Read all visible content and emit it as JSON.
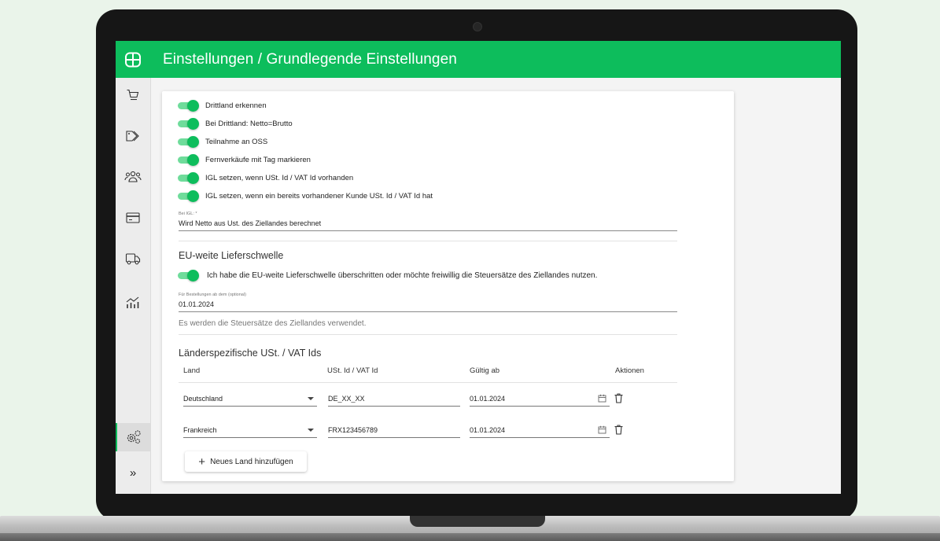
{
  "app": {
    "title": "Einstellungen / Grundlegende Einstellungen",
    "accent_color": "#0dbd5c"
  },
  "sidebar": {
    "items": [
      {
        "icon": "cart-icon"
      },
      {
        "icon": "tags-icon"
      },
      {
        "icon": "users-icon"
      },
      {
        "icon": "credit-card-icon"
      },
      {
        "icon": "truck-icon"
      },
      {
        "icon": "chart-icon"
      },
      {
        "icon": "settings-gears-icon",
        "active": true
      }
    ],
    "expand_label": "»"
  },
  "toggles": [
    {
      "label": "Drittland erkennen",
      "on": true
    },
    {
      "label": "Bei Drittland: Netto=Brutto",
      "on": true
    },
    {
      "label": "Teilnahme an OSS",
      "on": true
    },
    {
      "label": "Fernverkäufe mit Tag markieren",
      "on": true
    },
    {
      "label": "IGL setzen, wenn USt. Id / VAT Id vorhanden",
      "on": true
    },
    {
      "label": "IGL setzen, wenn ein bereits vorhandener Kunde USt. Id / VAT Id hat",
      "on": true
    }
  ],
  "igl_field": {
    "label": "Bei IGL: *",
    "value": "Wird Netto aus Ust. des Ziellandes berechnet"
  },
  "eu_section": {
    "title": "EU-weite Lieferschwelle",
    "toggle_label": "Ich habe die EU-weite Lieferschwelle überschritten oder möchte freiwillig die Steuersätze des Ziellandes nutzen.",
    "toggle_on": true,
    "date_field": {
      "label": "Für Bestellungen ab dem (optional)",
      "value": "01.01.2024"
    },
    "hint": "Es werden die Steuersätze des Ziellandes verwendet."
  },
  "vat_section": {
    "title": "Länderspezifische USt. / VAT Ids",
    "columns": [
      "Land",
      "USt. Id / VAT Id",
      "Gültig ab",
      "Aktionen"
    ],
    "rows": [
      {
        "country": "Deutschland",
        "vat_id": "DE_XX_XX",
        "valid_from": "01.01.2024"
      },
      {
        "country": "Frankreich",
        "vat_id": "FRX123456789",
        "valid_from": "01.01.2024"
      }
    ],
    "add_label": "Neues Land hinzufügen"
  }
}
